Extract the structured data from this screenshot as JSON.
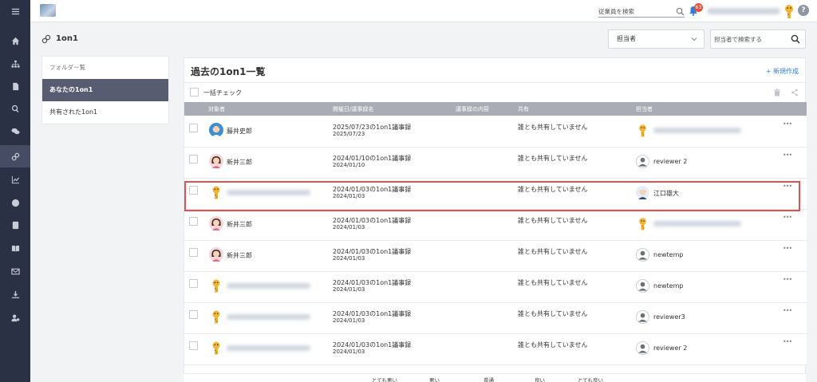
{
  "topbar": {
    "employee_search_placeholder": "従業員を検索",
    "notification_count": "63",
    "help_label": "?"
  },
  "page": {
    "title": "1on1"
  },
  "filters": {
    "owner_select_value": "担当者",
    "owner_search_placeholder": "担当者で検索する"
  },
  "folders": {
    "header": "フォルダー覧",
    "items": [
      {
        "label": "あなたの1on1",
        "active": true
      },
      {
        "label": "共有された1on1",
        "active": false
      }
    ]
  },
  "list": {
    "title": "過去の1on1一覧",
    "new_button": "+ 新規作成",
    "bulk_check": "一括チェック",
    "columns": {
      "subject": "対象者",
      "date": "開催日/議事録名",
      "content": "議事録の内容",
      "shared": "共有",
      "owner": "担当者"
    },
    "rows": [
      {
        "subject": "藤井史郎",
        "subject_avatar": "female-blue",
        "title": "2025/07/23の1on1議事録",
        "date": "2025/07/23",
        "shared": "誰とも共有していません",
        "owner": "",
        "owner_avatar": "giraffe"
      },
      {
        "subject": "新井三郎",
        "subject_avatar": "female-pink",
        "title": "2024/01/10の1on1議事録",
        "date": "2024/01/10",
        "shared": "誰とも共有していません",
        "owner": "reviewer 2",
        "owner_avatar": "person"
      },
      {
        "subject": "",
        "subject_avatar": "giraffe",
        "title": "2024/01/03の1on1議事録",
        "date": "2024/01/03",
        "shared": "誰とも共有していません",
        "owner": "江口雄大",
        "owner_avatar": "man"
      },
      {
        "subject": "新井三郎",
        "subject_avatar": "female-pink",
        "title": "2024/01/03の1on1議事録",
        "date": "2024/01/03",
        "shared": "誰とも共有していません",
        "owner": "",
        "owner_avatar": "giraffe"
      },
      {
        "subject": "新井三郎",
        "subject_avatar": "female-pink",
        "title": "2024/01/03の1on1議事録",
        "date": "2024/01/03",
        "shared": "誰とも共有していません",
        "owner": "newtemp",
        "owner_avatar": "person"
      },
      {
        "subject": "",
        "subject_avatar": "giraffe",
        "title": "2024/01/03の1on1議事録",
        "date": "2024/01/03",
        "shared": "誰とも共有していません",
        "owner": "newtemp",
        "owner_avatar": "person"
      },
      {
        "subject": "",
        "subject_avatar": "giraffe",
        "title": "2024/01/03の1on1議事録",
        "date": "2024/01/03",
        "shared": "誰とも共有していません",
        "owner": "reviewer3",
        "owner_avatar": "person"
      },
      {
        "subject": "",
        "subject_avatar": "giraffe",
        "title": "2024/01/03の1on1議事録",
        "date": "2024/01/03",
        "shared": "誰とも共有していません",
        "owner": "reviewer 2",
        "owner_avatar": "person"
      }
    ],
    "more_label": "•••"
  },
  "ratings": [
    "とても悪い",
    "悪い",
    "普通",
    "良い",
    "とても良い"
  ],
  "colors": {
    "sidebar": "#2b3145",
    "active_folder": "#575c70",
    "header_row": "#a9acb4",
    "accent": "#2e7ee0",
    "highlight": "#e05252"
  }
}
